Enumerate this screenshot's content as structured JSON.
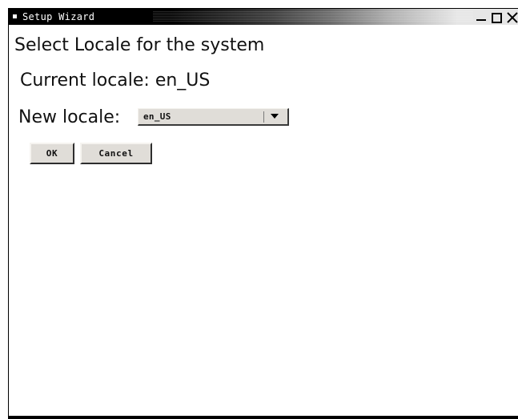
{
  "window": {
    "title": "Setup Wizard",
    "controls": [
      "minimize-icon",
      "maximize-icon",
      "close-icon"
    ]
  },
  "content": {
    "heading": "Select Locale for the system",
    "current_locale_text": "Current locale: en_US",
    "new_locale_label": "New locale:",
    "locale_select": {
      "selected": "en_US"
    }
  },
  "buttons": {
    "ok_label": "OK",
    "cancel_label": "Cancel"
  },
  "colors": {
    "titlebar": "#000000",
    "widget_bg": "#e0ddd8",
    "page_bg": "#ffffff"
  }
}
